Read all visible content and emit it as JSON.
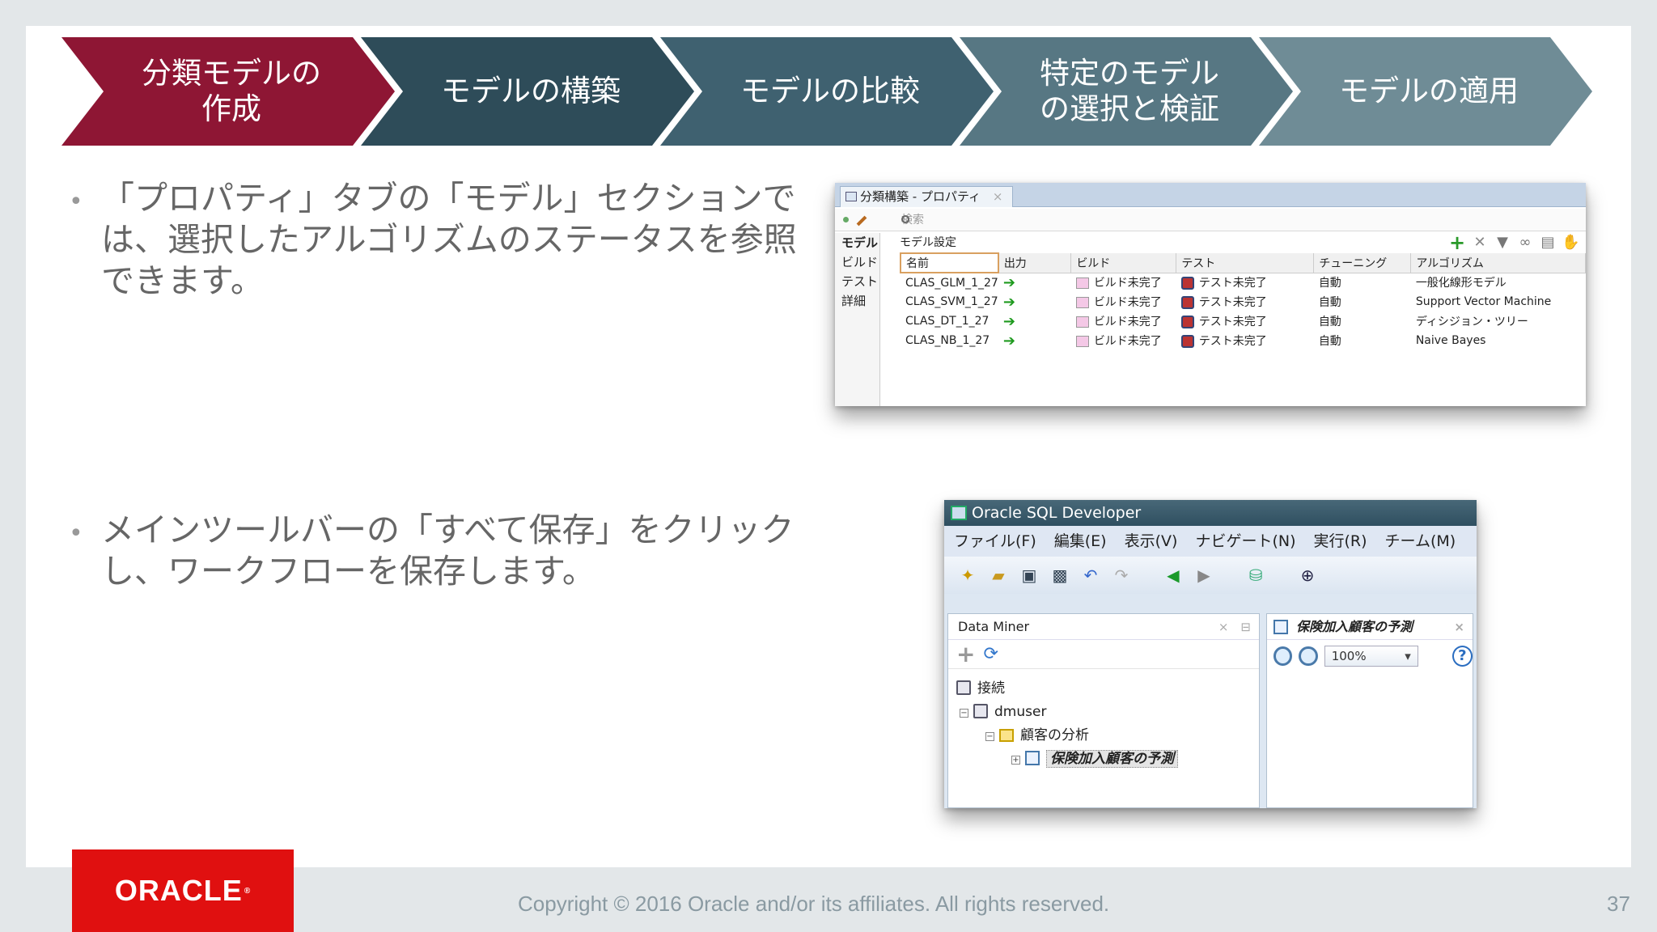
{
  "steps": [
    {
      "label": "分類モデルの\n作成",
      "color": "#8e1634",
      "active": true
    },
    {
      "label": "モデルの構築",
      "color": "#2e4c59"
    },
    {
      "label": "モデルの比較",
      "color": "#3f6170"
    },
    {
      "label": "特定のモデル\nの選択と検証",
      "color": "#577783"
    },
    {
      "label": "モデルの適用",
      "color": "#6f8c96"
    }
  ],
  "bullets": [
    "「プロパティ」タブの「モデル」セクションでは、選択したアルゴリズムのステータスを参照できます。",
    "メインツールバーの「すべて保存」をクリックし、ワークフローを保存します。"
  ],
  "props": {
    "tab_title": "分類構築 - プロパティ",
    "tab_close": "×",
    "search_placeholder": "検索",
    "side_items": [
      "モデル",
      "ビルド",
      "テスト",
      "詳細"
    ],
    "section_title": "モデル設定",
    "columns": [
      "名前",
      "出力",
      "ビルド",
      "テスト",
      "チューニング",
      "アルゴリズム"
    ],
    "rows": [
      {
        "name": "CLAS_GLM_1_27",
        "build": "ビルド未完了",
        "test": "テスト未完了",
        "tuning": "自動",
        "algorithm": "一般化線形モデル"
      },
      {
        "name": "CLAS_SVM_1_27",
        "build": "ビルド未完了",
        "test": "テスト未完了",
        "tuning": "自動",
        "algorithm": "Support Vector Machine"
      },
      {
        "name": "CLAS_DT_1_27",
        "build": "ビルド未完了",
        "test": "テスト未完了",
        "tuning": "自動",
        "algorithm": "ディシジョン・ツリー"
      },
      {
        "name": "CLAS_NB_1_27",
        "build": "ビルド未完了",
        "test": "テスト未完了",
        "tuning": "自動",
        "algorithm": "Naive Bayes"
      }
    ]
  },
  "sqldev": {
    "title": "Oracle SQL Developer",
    "menu": [
      "ファイル(F)",
      "編集(E)",
      "表示(V)",
      "ナビゲート(N)",
      "実行(R)",
      "チーム(M)"
    ],
    "left_panel_title": "Data Miner",
    "tree": {
      "root": "接続",
      "user": "dmuser",
      "project": "顧客の分析",
      "workflow": "保険加入顧客の予測"
    },
    "right_panel_title": "保険加入顧客の予測",
    "zoom": "100%",
    "close": "×"
  },
  "footer": {
    "logo": "ORACLE",
    "copyright": "Copyright © 2016 Oracle and/or its affiliates.  All rights reserved.",
    "page": "37"
  },
  "colors": {
    "oracle_red": "#e01010",
    "active_step": "#8e1634"
  }
}
